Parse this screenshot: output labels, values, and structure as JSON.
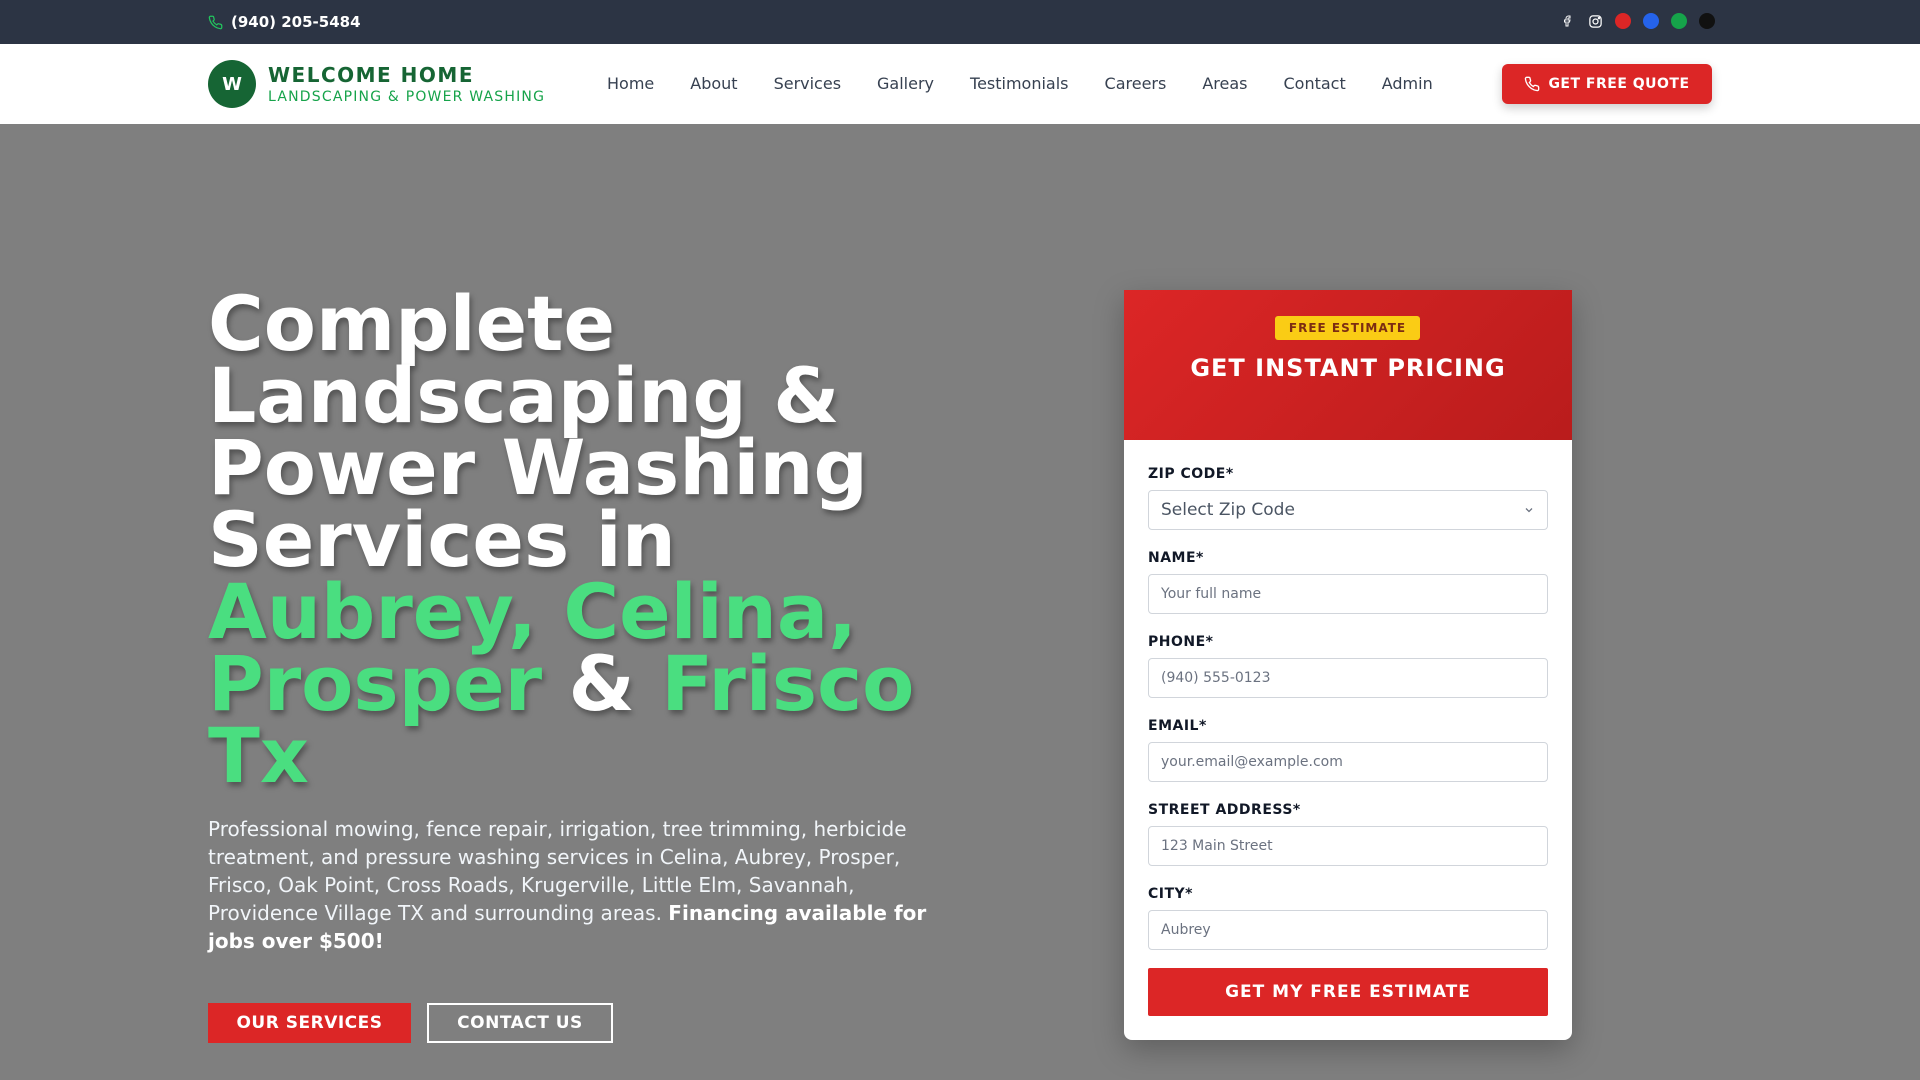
{
  "topbar": {
    "phone": "(940) 205-5484",
    "social_icons": [
      "facebook-icon",
      "instagram-icon"
    ],
    "color_dots": [
      "#dc2626",
      "#2563eb",
      "#16a34a",
      "#111111"
    ]
  },
  "header": {
    "logo_letter": "W",
    "brand_name": "WELCOME HOME",
    "brand_tagline": "LANDSCAPING & POWER WASHING",
    "nav": [
      "Home",
      "About",
      "Services",
      "Gallery",
      "Testimonials",
      "Careers",
      "Areas",
      "Contact",
      "Admin"
    ],
    "cta": "GET FREE QUOTE"
  },
  "hero": {
    "title_white_1": "Complete Landscaping & Power Washing Services in ",
    "title_green_1": "Aubrey, Celina, Prosper",
    "title_white_2": " & ",
    "title_green_2": "Frisco Tx",
    "description": "Professional mowing, fence repair, irrigation, tree trimming, herbicide treatment, and pressure washing services in Celina, Aubrey, Prosper, Frisco, Oak Point, Cross Roads, Krugerville, Little Elm, Savannah, Providence Village TX and surrounding areas. ",
    "description_bold": "Financing available for jobs over $500!",
    "primary_button": "OUR SERVICES",
    "secondary_button": "CONTACT US"
  },
  "form": {
    "badge": "FREE ESTIMATE",
    "title": "GET INSTANT PRICING",
    "zip": {
      "label": "ZIP CODE*",
      "value": "Select Zip Code"
    },
    "name": {
      "label": "NAME*",
      "placeholder": "Your full name"
    },
    "phone": {
      "label": "PHONE*",
      "placeholder": "(940) 555-0123"
    },
    "email": {
      "label": "EMAIL*",
      "placeholder": "your.email@example.com"
    },
    "address": {
      "label": "STREET ADDRESS*",
      "placeholder": "123 Main Street"
    },
    "city": {
      "label": "CITY*",
      "placeholder": "Aubrey"
    },
    "submit": "GET MY FREE ESTIMATE"
  },
  "colors": {
    "accent_red": "#dc2626",
    "brand_green": "#166534",
    "highlight_green": "#4ade80",
    "badge_yellow": "#facc15"
  }
}
